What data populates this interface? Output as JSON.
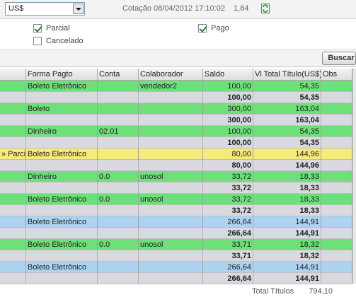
{
  "currency": {
    "selected": "US$"
  },
  "cotacao": {
    "label": "Cotação 08/04/2012 17:10:02",
    "value": "1,84"
  },
  "filters": {
    "parcial": {
      "label": "Parcial",
      "checked": true
    },
    "cancelado": {
      "label": "Cancelado",
      "checked": false
    },
    "pago": {
      "label": "Pago",
      "checked": true
    }
  },
  "toolbar": {
    "buscar_label": "Buscar"
  },
  "grid": {
    "headers": [
      "Forma Pagto",
      "Conta",
      "Colaborador",
      "Saldo",
      "Vl Total Título(US$)",
      "Obs"
    ],
    "rows": [
      {
        "status": "",
        "forma": "Boleto Eletrônico",
        "conta": "",
        "colab": "vendedor2",
        "saldo": "100,00",
        "total": "54,35",
        "obs": "",
        "kind": "green"
      },
      {
        "status": "",
        "forma": "",
        "conta": "",
        "colab": "",
        "saldo": "100,00",
        "total": "54,35",
        "obs": "",
        "kind": "grey"
      },
      {
        "status": "",
        "forma": "Boleto",
        "conta": "",
        "colab": "",
        "saldo": "300,00",
        "total": "163,04",
        "obs": "",
        "kind": "green"
      },
      {
        "status": "",
        "forma": "",
        "conta": "",
        "colab": "",
        "saldo": "300,00",
        "total": "163,04",
        "obs": "",
        "kind": "grey"
      },
      {
        "status": "",
        "forma": "Dinheiro",
        "conta": "02.01",
        "colab": "",
        "saldo": "100,00",
        "total": "54,35",
        "obs": "",
        "kind": "green"
      },
      {
        "status": "",
        "forma": "",
        "conta": "",
        "colab": "",
        "saldo": "100,00",
        "total": "54,35",
        "obs": "",
        "kind": "grey"
      },
      {
        "status": "Parcial",
        "forma": "Boleto Eletrônico",
        "conta": "",
        "colab": "",
        "saldo": "80,00",
        "total": "144,96",
        "obs": "",
        "kind": "yellow"
      },
      {
        "status": "",
        "forma": "",
        "conta": "",
        "colab": "",
        "saldo": "80,00",
        "total": "144,96",
        "obs": "",
        "kind": "grey"
      },
      {
        "status": "",
        "forma": "Dinheiro",
        "conta": "0.0",
        "colab": "unosol",
        "saldo": "33,72",
        "total": "18,33",
        "obs": "",
        "kind": "green"
      },
      {
        "status": "",
        "forma": "",
        "conta": "",
        "colab": "",
        "saldo": "33,72",
        "total": "18,33",
        "obs": "",
        "kind": "grey"
      },
      {
        "status": "",
        "forma": "Boleto Eletrônico",
        "conta": "0.0",
        "colab": "unosol",
        "saldo": "33,72",
        "total": "18,33",
        "obs": "",
        "kind": "green"
      },
      {
        "status": "",
        "forma": "",
        "conta": "",
        "colab": "",
        "saldo": "33,72",
        "total": "18,33",
        "obs": "",
        "kind": "grey"
      },
      {
        "status": "",
        "forma": "Boleto Eletrônico",
        "conta": "",
        "colab": "",
        "saldo": "266,64",
        "total": "144,91",
        "obs": "",
        "kind": "blue"
      },
      {
        "status": "",
        "forma": "",
        "conta": "",
        "colab": "",
        "saldo": "266,64",
        "total": "144,91",
        "obs": "",
        "kind": "grey"
      },
      {
        "status": "",
        "forma": "Boleto Eletrônico",
        "conta": "0.0",
        "colab": "unosol",
        "saldo": "33,71",
        "total": "18,32",
        "obs": "",
        "kind": "green"
      },
      {
        "status": "",
        "forma": "",
        "conta": "",
        "colab": "",
        "saldo": "33,71",
        "total": "18,32",
        "obs": "",
        "kind": "grey"
      },
      {
        "status": "",
        "forma": "Boleto Eletrônico",
        "conta": "",
        "colab": "",
        "saldo": "266,64",
        "total": "144,91",
        "obs": "",
        "kind": "blue"
      },
      {
        "status": "",
        "forma": "",
        "conta": "",
        "colab": "",
        "saldo": "266,64",
        "total": "144,91",
        "obs": "",
        "kind": "grey"
      }
    ]
  },
  "totals": {
    "label": "Total Títulos",
    "value": "794,10"
  }
}
